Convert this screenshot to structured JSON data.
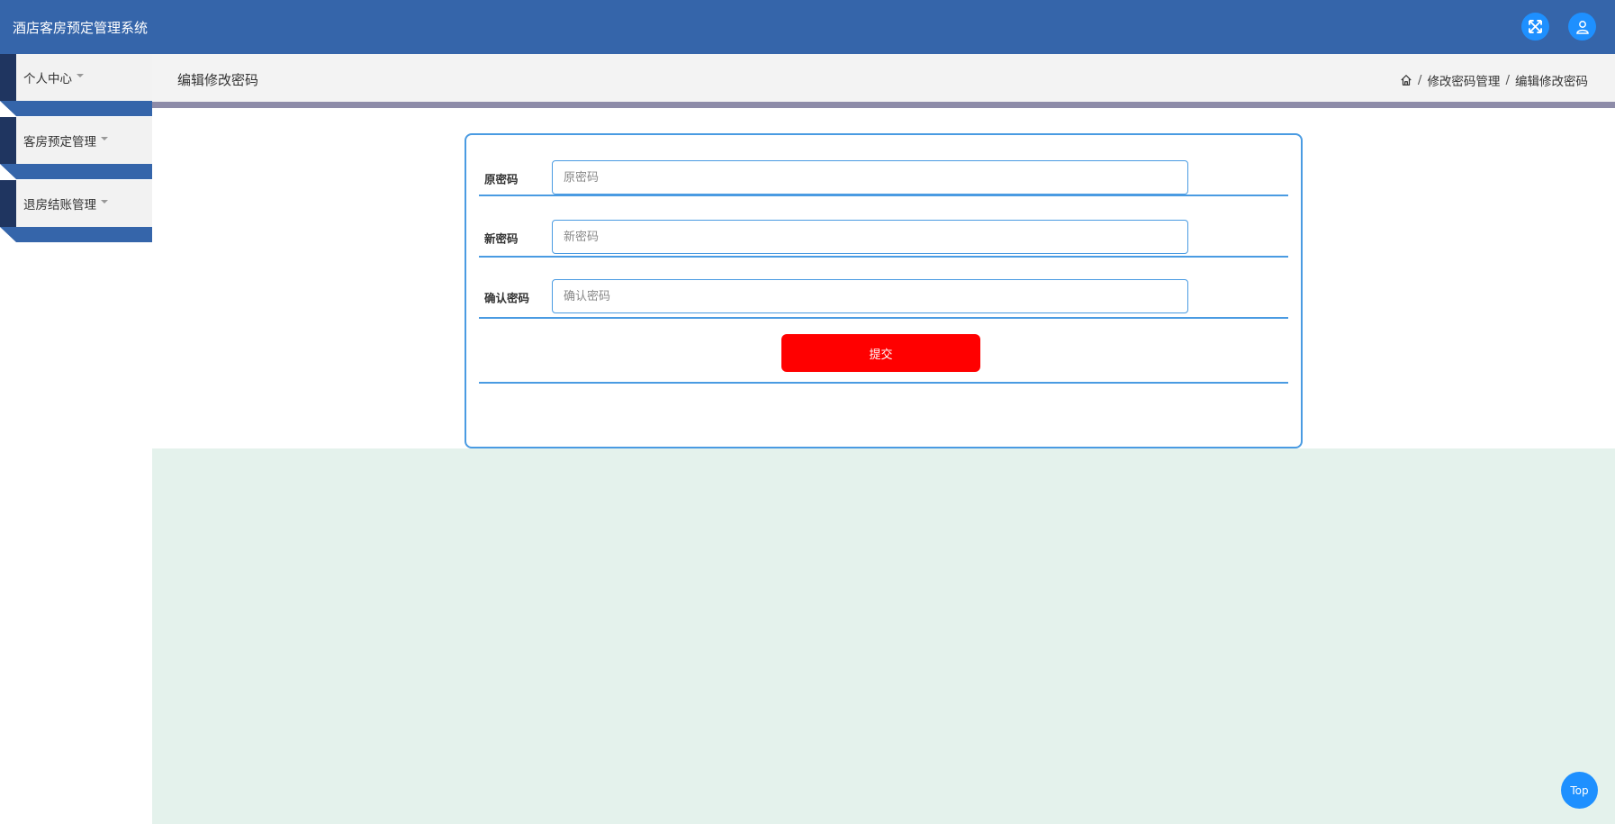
{
  "header": {
    "title": "酒店客房预定管理系统",
    "icons": [
      "fullscreen-icon",
      "user-icon"
    ],
    "bg_color": "#3565aa",
    "icon_color": "#1e90ff"
  },
  "sidebar": {
    "items": [
      {
        "label": "个人中心"
      },
      {
        "label": "客房预定管理"
      },
      {
        "label": "退房结账管理"
      }
    ]
  },
  "page": {
    "title": "编辑修改密码",
    "breadcrumb": [
      "修改密码管理",
      "编辑修改密码"
    ],
    "breadcrumb_separator": "/"
  },
  "form": {
    "fields": [
      {
        "label": "原密码",
        "placeholder": "原密码",
        "value": ""
      },
      {
        "label": "新密码",
        "placeholder": "新密码",
        "value": ""
      },
      {
        "label": "确认密码",
        "placeholder": "确认密码",
        "value": ""
      }
    ],
    "submit_label": "提交",
    "submit_color": "#ff0000",
    "border_color": "#4a9be2"
  },
  "back_to_top": {
    "label": "Top"
  }
}
